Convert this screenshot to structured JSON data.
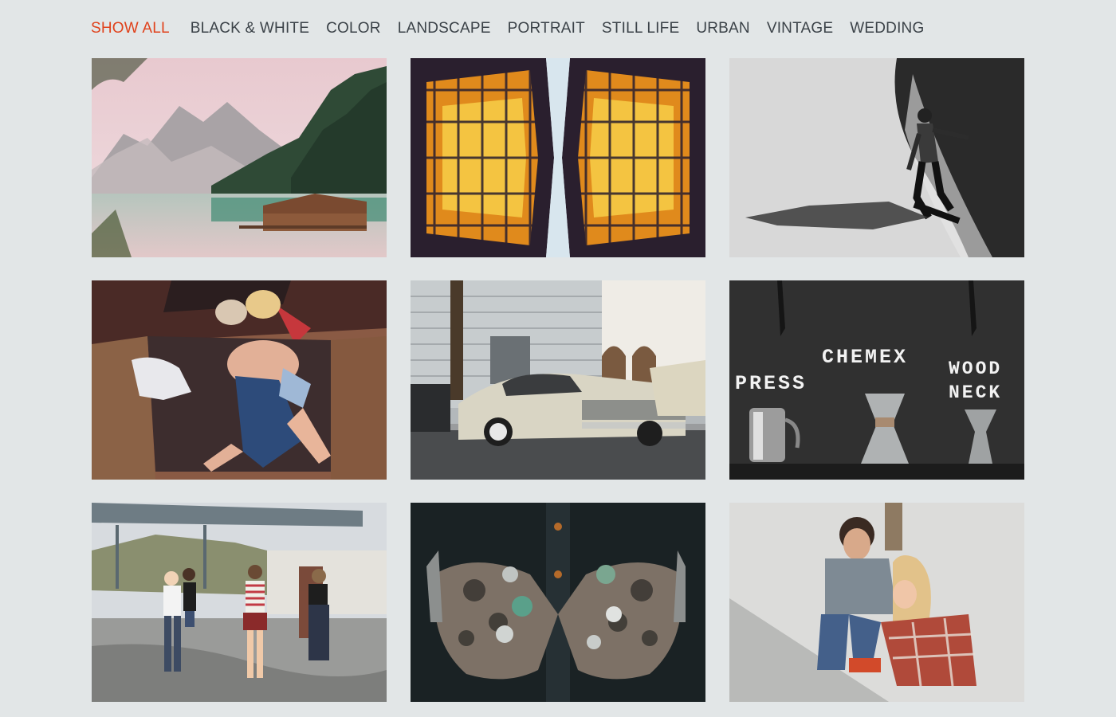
{
  "filters": [
    {
      "label": "SHOW ALL",
      "active": true
    },
    {
      "label": "BLACK & WHITE",
      "active": false
    },
    {
      "label": "COLOR",
      "active": false
    },
    {
      "label": "LANDSCAPE",
      "active": false
    },
    {
      "label": "PORTRAIT",
      "active": false
    },
    {
      "label": "STILL LIFE",
      "active": false
    },
    {
      "label": "URBAN",
      "active": false
    },
    {
      "label": "VINTAGE",
      "active": false
    },
    {
      "label": "WEDDING",
      "active": false
    }
  ],
  "colors": {
    "background": "#e2e6e7",
    "filter_text": "#3b4248",
    "filter_active": "#e0421c"
  },
  "gallery": {
    "still_life": {
      "word_press": "PRESS",
      "word_chemex": "CHEMEX",
      "word_wood": "WOOD",
      "word_neck": "NECK"
    }
  }
}
